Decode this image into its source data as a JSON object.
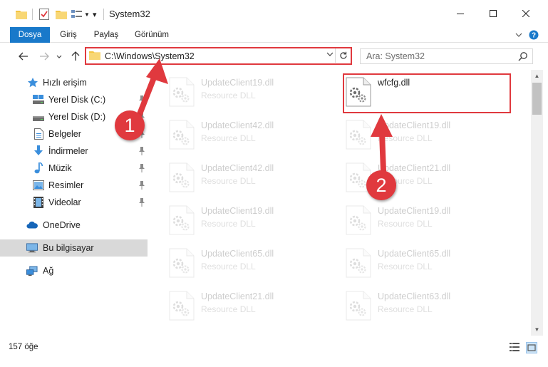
{
  "window": {
    "title": "System32"
  },
  "ribbon": {
    "tabs": [
      "Dosya",
      "Giriş",
      "Paylaş",
      "Görünüm"
    ]
  },
  "address": {
    "path": "C:\\Windows\\System32"
  },
  "search": {
    "placeholder": "Ara: System32"
  },
  "nav": {
    "items": [
      {
        "label": "Hızlı erişim",
        "icon": "star-icon",
        "pinned": false
      },
      {
        "label": "Yerel Disk (C:)",
        "icon": "drive-icon",
        "pinned": true
      },
      {
        "label": "Yerel Disk (D:)",
        "icon": "drive-icon",
        "pinned": true
      },
      {
        "label": "Belgeler",
        "icon": "document-icon",
        "pinned": true
      },
      {
        "label": "İndirmeler",
        "icon": "download-icon",
        "pinned": true
      },
      {
        "label": "Müzik",
        "icon": "music-icon",
        "pinned": true
      },
      {
        "label": "Resimler",
        "icon": "pictures-icon",
        "pinned": true
      },
      {
        "label": "Videolar",
        "icon": "video-icon",
        "pinned": true
      },
      {
        "label": "OneDrive",
        "icon": "cloud-icon",
        "pinned": false
      },
      {
        "label": "Bu bilgisayar",
        "icon": "computer-icon",
        "pinned": false
      },
      {
        "label": "Ağ",
        "icon": "network-icon",
        "pinned": false
      }
    ]
  },
  "files": {
    "left": [
      {
        "name": "UpdateClient19.dll",
        "type": "Resource DLL"
      },
      {
        "name": "UpdateClient42.dll",
        "type": "Resource DLL"
      },
      {
        "name": "UpdateClient42.dll",
        "type": "Resource DLL"
      },
      {
        "name": "UpdateClient19.dll",
        "type": "Resource DLL"
      },
      {
        "name": "UpdateClient65.dll",
        "type": "Resource DLL"
      },
      {
        "name": "UpdateClient21.dll",
        "type": "Resource DLL"
      }
    ],
    "right": [
      {
        "name": "wfcfg.dll",
        "type": ""
      },
      {
        "name": "UpdateClient19.dll",
        "type": "Resource DLL"
      },
      {
        "name": "UpdateClient21.dll",
        "type": "Resource DLL"
      },
      {
        "name": "UpdateClient19.dll",
        "type": "Resource DLL"
      },
      {
        "name": "UpdateClient65.dll",
        "type": "Resource DLL"
      },
      {
        "name": "UpdateClient63.dll",
        "type": "Resource DLL"
      }
    ]
  },
  "status": {
    "count": "157 öğe"
  },
  "annotations": {
    "badge1": "1",
    "badge2": "2",
    "color": "#e0393e"
  },
  "colors": {
    "accent": "#1979ca",
    "highlight": "#e0393e",
    "folder": "#f4c542"
  }
}
